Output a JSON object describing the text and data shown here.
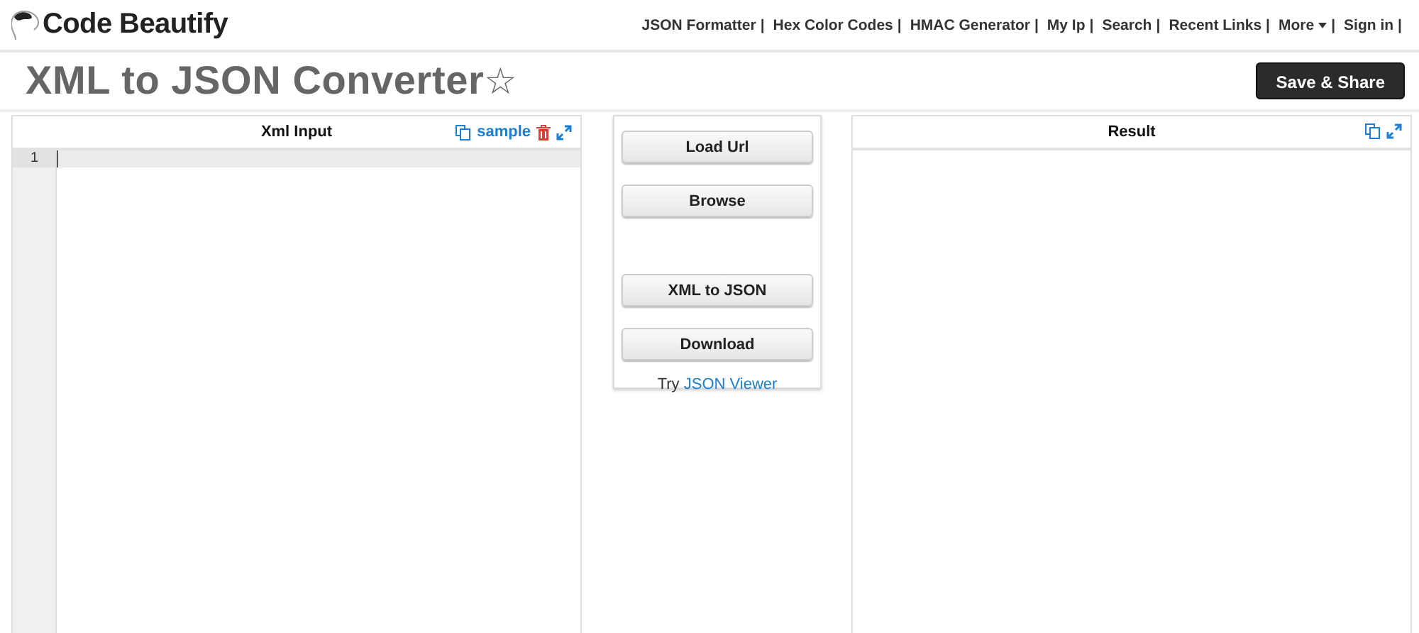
{
  "header": {
    "logo": "Code Beautify",
    "nav": [
      {
        "label": "JSON Formatter",
        "separator": "|",
        "kind": "link"
      },
      {
        "label": "Hex Color Codes",
        "separator": "|",
        "kind": "link"
      },
      {
        "label": "HMAC Generator",
        "separator": "|",
        "kind": "link"
      },
      {
        "label": "My Ip",
        "separator": "|",
        "kind": "link"
      },
      {
        "label": "Search",
        "separator": "|",
        "kind": "link"
      },
      {
        "label": "Recent Links",
        "separator": "|",
        "kind": "link"
      },
      {
        "label": "More",
        "separator": "|",
        "kind": "dropdown"
      },
      {
        "label": "Sign in",
        "separator": "|",
        "kind": "link"
      }
    ]
  },
  "page_title": {
    "text": "XML to JSON Converter",
    "star": "☆"
  },
  "save_button": "Save & Share",
  "input_panel": {
    "title": "Xml Input",
    "sample_link": "sample",
    "line_numbers": [
      "1"
    ]
  },
  "actions": {
    "groups": [
      [
        "Load Url",
        "Browse"
      ],
      [
        "XML to JSON",
        "Download"
      ]
    ],
    "try_text": "Try",
    "try_link": "JSON Viewer"
  },
  "result_panel": {
    "title": "Result"
  }
}
